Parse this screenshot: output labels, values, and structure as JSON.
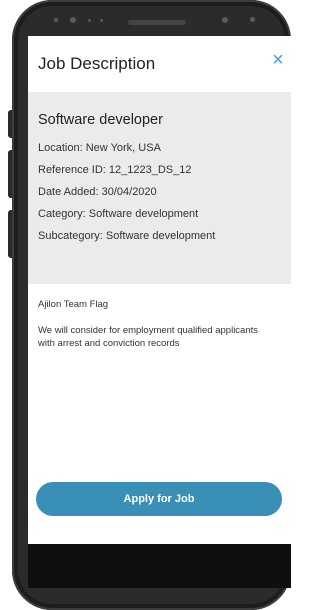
{
  "header": {
    "title": "Job Description",
    "close_label": "×",
    "close_icon": "close-icon"
  },
  "job": {
    "title": "Software developer",
    "location": "Location: New York, USA",
    "reference": "Reference ID: 12_1223_DS_12",
    "date_added": "Date Added: 30/04/2020",
    "category": "Category: Software development",
    "subcategory": "Subcategory: Software development"
  },
  "body": {
    "flag_label": "Ajilon Team Flag",
    "description_line1": "We will consider for employment qualified applicants",
    "description_line2": "with arrest and conviction records"
  },
  "actions": {
    "apply_label": "Apply for Job"
  },
  "colors": {
    "accent": "#3aa4d6",
    "button": "#3a8fb7",
    "panel": "#ebebeb"
  }
}
